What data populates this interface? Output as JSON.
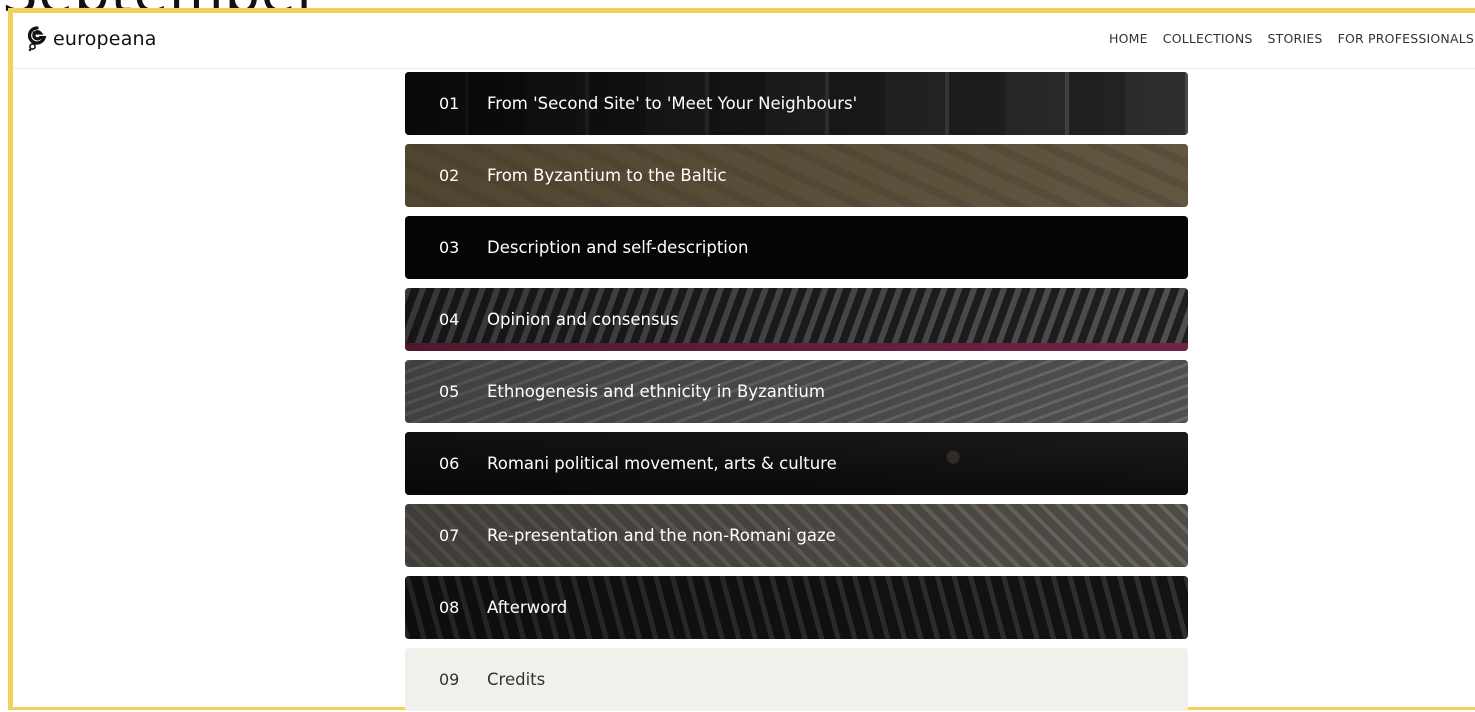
{
  "background_text": "September",
  "header": {
    "logo_text": "europeana",
    "nav": [
      "HOME",
      "COLLECTIONS",
      "STORIES",
      "FOR PROFESSIONALS"
    ]
  },
  "chapters": [
    {
      "number": "01",
      "title": "From 'Second Site' to 'Meet Your Neighbours'"
    },
    {
      "number": "02",
      "title": "From Byzantium to the Baltic"
    },
    {
      "number": "03",
      "title": "Description and self-description"
    },
    {
      "number": "04",
      "title": "Opinion and consensus"
    },
    {
      "number": "05",
      "title": "Ethnogenesis and ethnicity in Byzantium"
    },
    {
      "number": "06",
      "title": "Romani political movement, arts & culture"
    },
    {
      "number": "07",
      "title": "Re-presentation and the non-Romani gaze"
    },
    {
      "number": "08",
      "title": "Afterword"
    },
    {
      "number": "09",
      "title": "Credits"
    }
  ],
  "colors": {
    "frame_border": "#f3d15a",
    "credits_background": "#f1f0eb"
  }
}
